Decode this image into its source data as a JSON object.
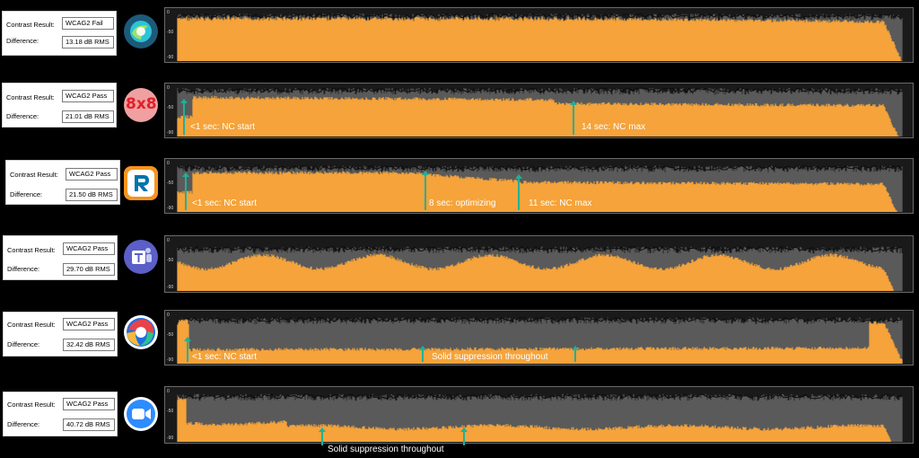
{
  "labels": {
    "contrast": "Contrast Result:",
    "difference": "Difference:"
  },
  "ticks": {
    "top": "0",
    "mid": "-50",
    "bottom": "-90"
  },
  "colors": {
    "accent_arrow": "#1fb09a",
    "waveform_fill": "#f5a33a",
    "waveform_bg": "#5a5a5a"
  },
  "rows": [
    {
      "app": "Webex",
      "logo_icon": "webex-logo-icon",
      "contrast": "WCAG2 Fail",
      "difference": "13.18 dB RMS",
      "annotations": []
    },
    {
      "app": "8x8",
      "logo_icon": "8x8-logo-icon",
      "logo_text": "8x8",
      "contrast": "WCAG2 Pass",
      "difference": "21.01 dB RMS",
      "annotations": [
        {
          "text": "<1 sec: NC start"
        },
        {
          "text": "14 sec: NC max"
        }
      ]
    },
    {
      "app": "RingCentral",
      "logo_icon": "ringcentral-logo-icon",
      "contrast": "WCAG2 Pass",
      "difference": "21.50 dB RMS",
      "annotations": [
        {
          "text": "<1 sec: NC start"
        },
        {
          "text": "8 sec: optimizing"
        },
        {
          "text": "11 sec: NC max"
        }
      ]
    },
    {
      "app": "Microsoft Teams",
      "logo_icon": "teams-logo-icon",
      "contrast": "WCAG2 Pass",
      "difference": "29.70 dB RMS",
      "annotations": []
    },
    {
      "app": "Webex (new)",
      "logo_icon": "webex-new-logo-icon",
      "contrast": "WCAG2 Pass",
      "difference": "32.42 dB RMS",
      "annotations": [
        {
          "text": "<1 sec: NC start"
        },
        {
          "text": "Solid suppression throughout"
        }
      ]
    },
    {
      "app": "Zoom",
      "logo_icon": "zoom-logo-icon",
      "contrast": "WCAG2 Pass",
      "difference": "40.72 dB RMS",
      "annotations": [
        {
          "text": "Solid suppression throughout"
        }
      ]
    }
  ]
}
